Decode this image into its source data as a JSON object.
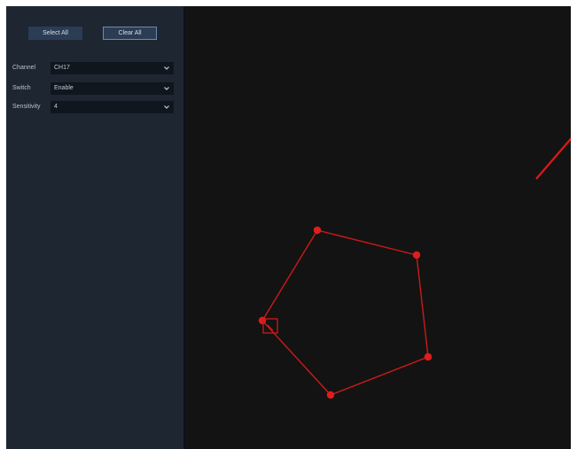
{
  "toolbar": {
    "select_all_label": "Select All",
    "clear_all_label": "Clear All"
  },
  "settings": {
    "channel": {
      "label": "Channel",
      "value": "CH17"
    },
    "switch": {
      "label": "Switch",
      "value": "Enable"
    },
    "sensitivity": {
      "label": "Sensitivity",
      "value": "4"
    }
  },
  "icons": {
    "dropdown": "chevron-down-icon",
    "vertex": "vertex-handle-icon",
    "selected_vertex": "selected-vertex-box-icon"
  },
  "colors": {
    "panel_bg": "#1e2631",
    "canvas_bg": "#131313",
    "button_bg": "#2b3d55",
    "region_stroke": "#d01818",
    "vertex_fill": "#e01c1c"
  }
}
